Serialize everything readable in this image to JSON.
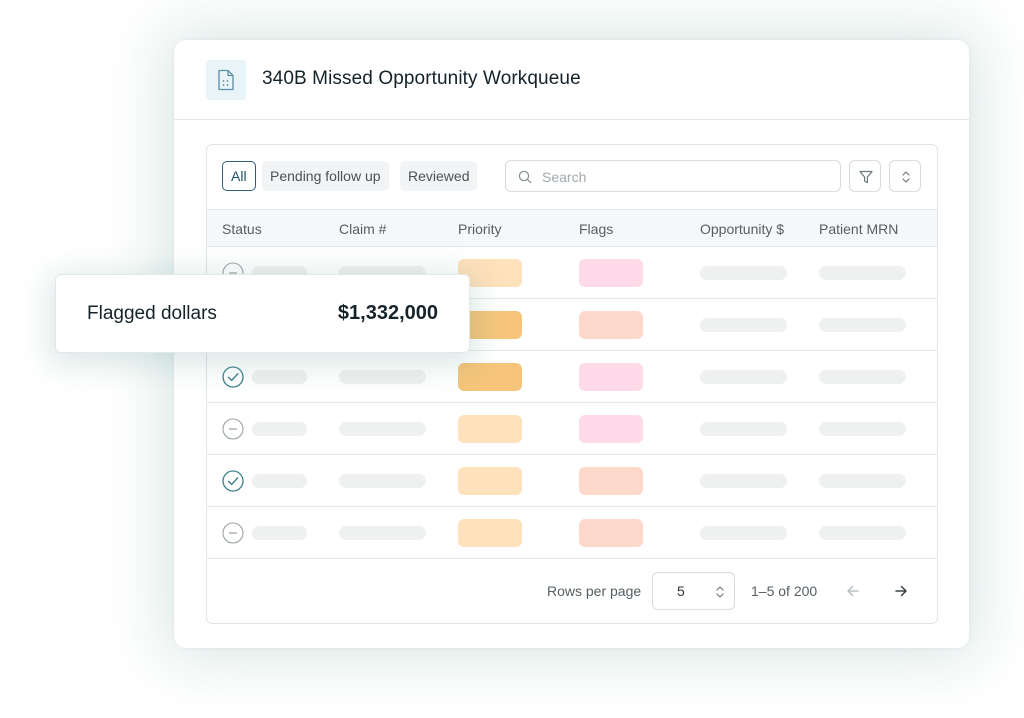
{
  "header": {
    "title": "340B Missed Opportunity Workqueue",
    "icon": "document-icon"
  },
  "tabs": [
    {
      "label": "All",
      "active": true
    },
    {
      "label": "Pending follow up",
      "active": false
    },
    {
      "label": "Reviewed",
      "active": false
    }
  ],
  "search": {
    "placeholder": "Search"
  },
  "columns": [
    "Status",
    "Claim #",
    "Priority",
    "Flags",
    "Opportunity $",
    "Patient MRN"
  ],
  "rows": [
    {
      "status": "minus",
      "priority_color": "#ffe1bb",
      "flag_color": "#ffdae8"
    },
    {
      "status": "minus",
      "priority_color": "#f6c57a",
      "flag_color": "#ffd8cc"
    },
    {
      "status": "check",
      "priority_color": "#f6c57a",
      "flag_color": "#ffdae8"
    },
    {
      "status": "minus",
      "priority_color": "#ffe1bb",
      "flag_color": "#ffdae8"
    },
    {
      "status": "check",
      "priority_color": "#ffe1bb",
      "flag_color": "#ffd8cc"
    },
    {
      "status": "minus",
      "priority_color": "#ffe1bb",
      "flag_color": "#ffd8cc"
    }
  ],
  "footer": {
    "rows_per_page_label": "Rows per page",
    "rows_per_page_value": "5",
    "range_text": "1–5 of 200"
  },
  "popup": {
    "label": "Flagged dollars",
    "value": "$1,332,000"
  },
  "colors": {
    "accent": "#2e5f7a",
    "check": "#3d7f8c",
    "muted": "#9aa3a7"
  }
}
